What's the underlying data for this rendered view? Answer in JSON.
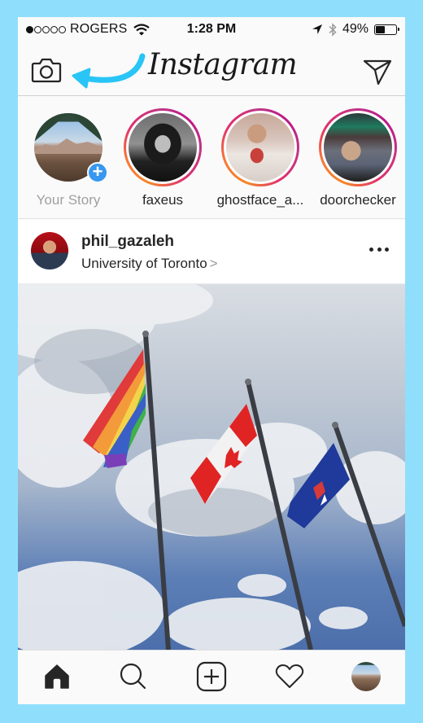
{
  "status_bar": {
    "signal_bars_filled": 1,
    "signal_bars_total": 5,
    "carrier": "ROGERS",
    "time": "1:28 PM",
    "battery_text": "49%",
    "battery_level": 0.49,
    "icons": [
      "wifi-icon",
      "location-arrow-icon",
      "bluetooth-icon",
      "battery-icon"
    ]
  },
  "header": {
    "logo": "Instagram",
    "left_icon": "camera-icon",
    "right_icon": "direct-message-icon",
    "annotation_color": "#29c5f6"
  },
  "stories": [
    {
      "label": "Your Story",
      "own": true,
      "badge": "+"
    },
    {
      "label": "faxeus",
      "own": false
    },
    {
      "label": "ghostface_a...",
      "own": false
    },
    {
      "label": "doorchecker",
      "own": false
    }
  ],
  "post": {
    "username": "phil_gazaleh",
    "location": "University of Toronto",
    "location_chevron": ">",
    "more_icon": "more-horizontal-icon",
    "photo_description": "Three flags (rainbow pride, Canada, Toronto) on flagpoles against a cloudy blue sky"
  },
  "bottom_nav": {
    "tabs": [
      {
        "name": "home",
        "icon": "home-icon",
        "active": true
      },
      {
        "name": "search",
        "icon": "search-icon",
        "active": false
      },
      {
        "name": "new-post",
        "icon": "add-post-icon",
        "active": false
      },
      {
        "name": "activity",
        "icon": "heart-icon",
        "active": false
      },
      {
        "name": "profile",
        "icon": "profile-avatar",
        "active": false
      }
    ]
  },
  "colors": {
    "background_frame": "#8fdffc",
    "story_ring_start": "#f58529",
    "story_ring_end": "#bc1888",
    "add_badge": "#3897f0",
    "text_primary": "#262626",
    "text_muted": "#a0a0a0"
  }
}
